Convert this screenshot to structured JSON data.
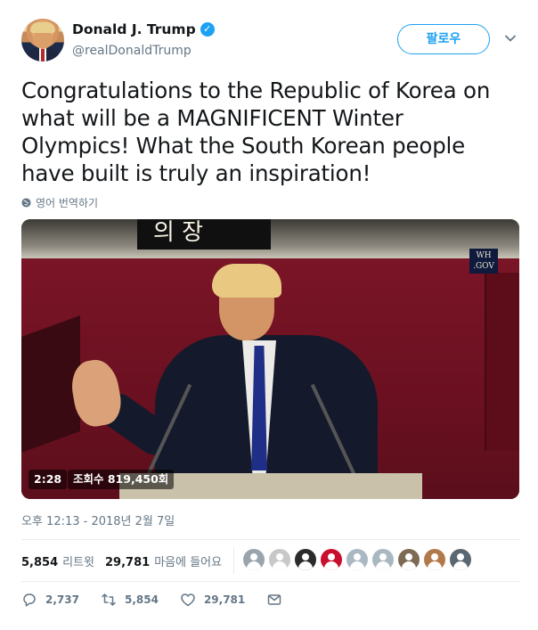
{
  "tweet": {
    "display_name": "Donald J. Trump",
    "handle": "@realDonaldTrump",
    "verified_symbol": "✓",
    "follow_label": "팔로우",
    "text": "Congratulations to the Republic of Korea on what will be a MAGNIFICENT Winter Olympics! What the South Korean people have built is truly an inspiration!",
    "translate_label": "영어 번역하기",
    "media": {
      "duration": "2:28",
      "views": "조회수 819,450회",
      "watermark_line1": "WH",
      "watermark_line2": ".GOV",
      "sign_text": "의 장"
    },
    "timestamp": "오후 12:13 - 2018년 2월 7일",
    "stats": {
      "retweets_count": "5,854",
      "retweets_label": "리트윗",
      "likes_count": "29,781",
      "likes_label": "마음에 들어요"
    },
    "actions": {
      "reply_count": "2,737",
      "retweet_count": "5,854",
      "like_count": "29,781"
    },
    "liker_colors": [
      "#9aa4ad",
      "#c8c8c8",
      "#2b2b2b",
      "#c8102e",
      "#aab8c2",
      "#aab8c2",
      "#7d6a55",
      "#b27a4b",
      "#5a6670"
    ]
  },
  "colors": {
    "accent": "#1da1f2",
    "text": "#14171a",
    "muted": "#657786"
  }
}
